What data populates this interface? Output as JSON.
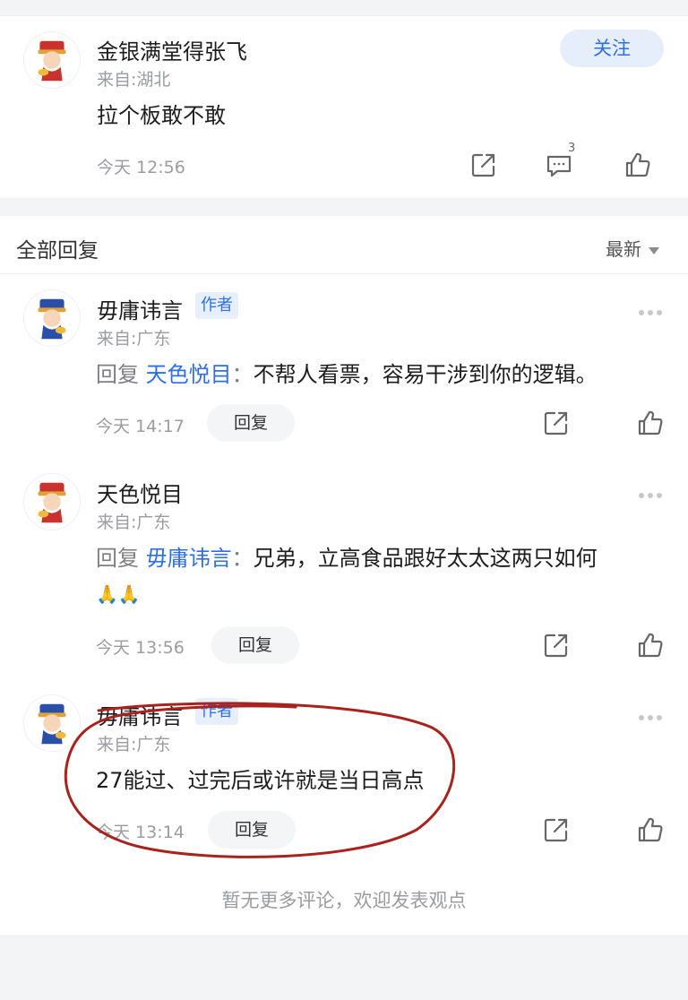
{
  "post": {
    "username": "金银满堂得张飞",
    "location": "来自:湖北",
    "content": "拉个板敢不敢",
    "time": "今天 12:56",
    "follow_label": "关注",
    "comment_count": "3",
    "icons": [
      "share-icon",
      "comment-icon",
      "like-icon"
    ]
  },
  "replies_header": {
    "title": "全部回复",
    "sort_label": "最新"
  },
  "replies": [
    {
      "username": "毋庸讳言",
      "tag": "作者",
      "location": "来自:广东",
      "reply_word": "回复",
      "mention": "天色悦目",
      "separator": "：",
      "text": "不帮人看票，容易干涉到你的逻辑。",
      "time": "今天 14:17",
      "reply_button": "回复"
    },
    {
      "username": "天色悦目",
      "location": "来自:广东",
      "reply_word": "回复",
      "mention": "毋庸讳言",
      "separator": "：",
      "text": "兄弟，立高食品跟好太太这两只如何",
      "emoji": "🙏🙏",
      "time": "今天 13:56",
      "reply_button": "回复"
    },
    {
      "username": "毋庸讳言",
      "tag": "作者",
      "location": "来自:广东",
      "text": "27能过、过完后或许就是当日高点",
      "time": "今天 13:14",
      "reply_button": "回复"
    }
  ],
  "footer": "暂无更多评论，欢迎发表观点",
  "colors": {
    "accent": "#2f6fe6",
    "annotation": "#a8231d"
  }
}
